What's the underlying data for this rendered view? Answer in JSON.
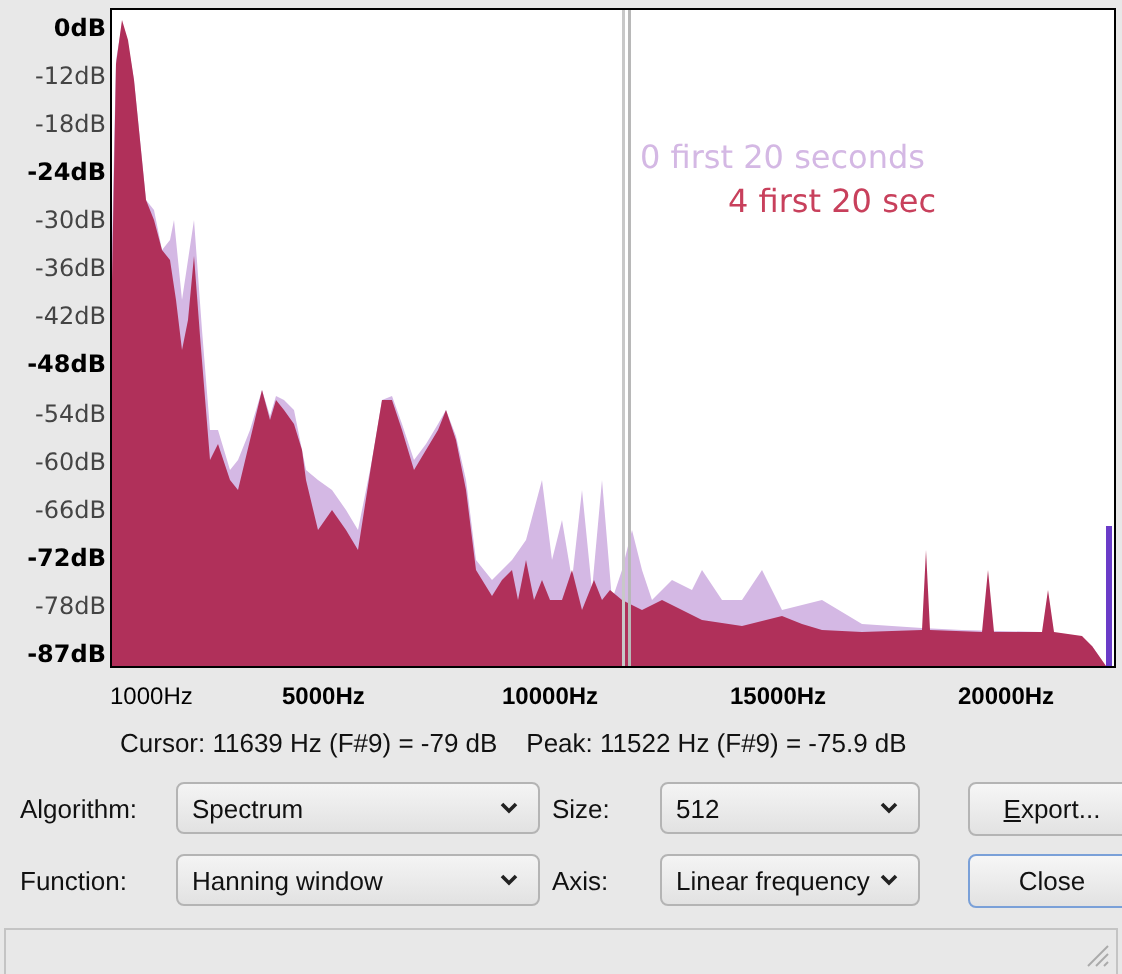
{
  "plot": {
    "y_ticks": [
      {
        "label": "0dB",
        "major": true
      },
      {
        "label": "-12dB",
        "major": false
      },
      {
        "label": "-18dB",
        "major": false
      },
      {
        "label": "-24dB",
        "major": true
      },
      {
        "label": "-30dB",
        "major": false
      },
      {
        "label": "-36dB",
        "major": false
      },
      {
        "label": "-42dB",
        "major": false
      },
      {
        "label": "-48dB",
        "major": true
      },
      {
        "label": "-54dB",
        "major": false
      },
      {
        "label": "-60dB",
        "major": false
      },
      {
        "label": "-66dB",
        "major": false
      },
      {
        "label": "-72dB",
        "major": true
      },
      {
        "label": "-78dB",
        "major": false
      },
      {
        "label": "-87dB",
        "major": true
      }
    ],
    "x_ticks": [
      {
        "label": "1000Hz",
        "major": false
      },
      {
        "label": "5000Hz",
        "major": true
      },
      {
        "label": "10000Hz",
        "major": true
      },
      {
        "label": "15000Hz",
        "major": true
      },
      {
        "label": "20000Hz",
        "major": true
      }
    ],
    "legend": [
      {
        "label": "0 first 20 seconds",
        "color": "#d4b8e4"
      },
      {
        "label": "4 first 20 sec",
        "color": "#c8405c"
      }
    ]
  },
  "readout": "Cursor: 11639 Hz (F#9) = -79 dB    Peak: 11522 Hz (F#9) = -75.9 dB",
  "controls": [
    {
      "label": "Algorithm:",
      "value": "Spectrum",
      "size_label": "Size:",
      "size_value": "512"
    },
    {
      "label": "Function:",
      "value": "Hanning window",
      "size_label": "Axis:",
      "size_value": "Linear frequency"
    }
  ],
  "buttons": [
    {
      "label": "Export...",
      "accel_first": true,
      "focused": false
    },
    {
      "label": "Close",
      "accel_first": false,
      "focused": true
    }
  ]
}
